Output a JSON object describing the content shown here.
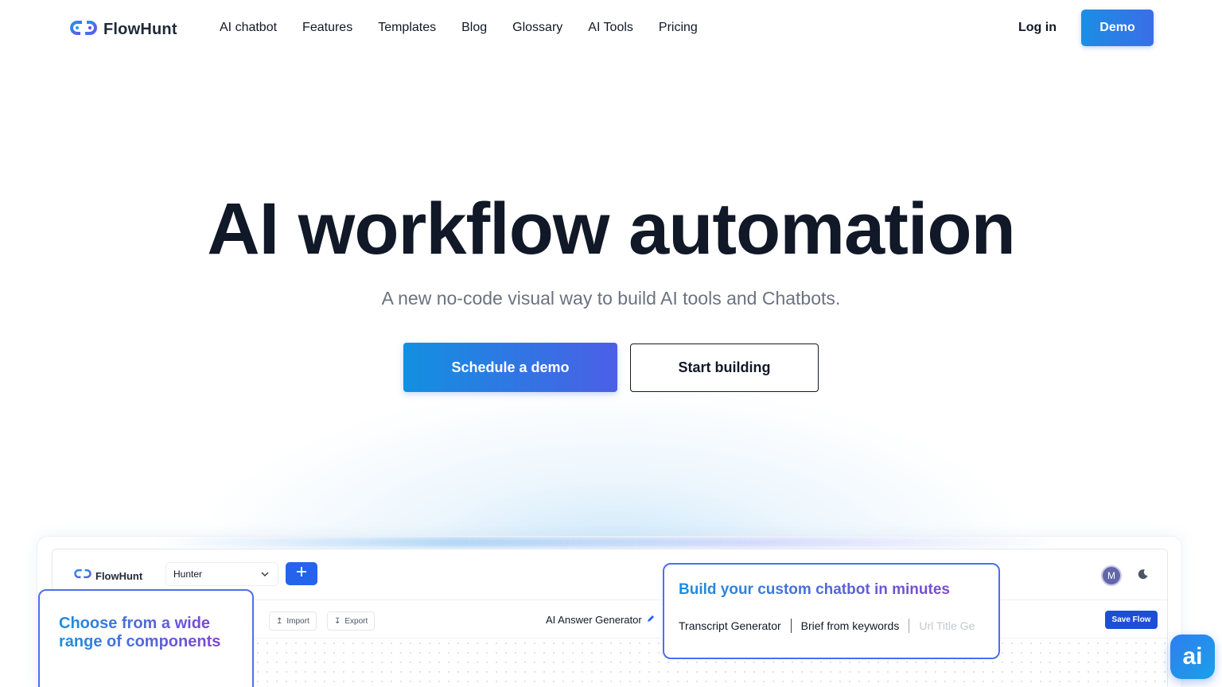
{
  "brand": {
    "name": "FlowHunt",
    "icon": "flowhunt-logo-icon",
    "accent": "#2563eb"
  },
  "nav": {
    "links": [
      "AI chatbot",
      "Features",
      "Templates",
      "Blog",
      "Glossary",
      "AI Tools",
      "Pricing"
    ],
    "login": "Log in",
    "demo": "Demo"
  },
  "hero": {
    "title": "AI workflow automation",
    "subtitle": "A new no-code visual way to build AI tools and Chatbots.",
    "cta_primary": "Schedule a demo",
    "cta_secondary": "Start building"
  },
  "preview": {
    "logo": "FlowHunt",
    "workspace": "Hunter",
    "avatar_initial": "M",
    "import_label": "Import",
    "export_label": "Export",
    "flow_title": "AI Answer Generator",
    "save_label": "Save Flow"
  },
  "cards": {
    "components_title": "Choose from a wide range of components",
    "chatbot_title": "Build your custom chatbot in minutes",
    "chips": [
      "Transcript Generator",
      "Brief from keywords",
      "Url Title Ge"
    ]
  },
  "widget": {
    "label": "ai"
  }
}
